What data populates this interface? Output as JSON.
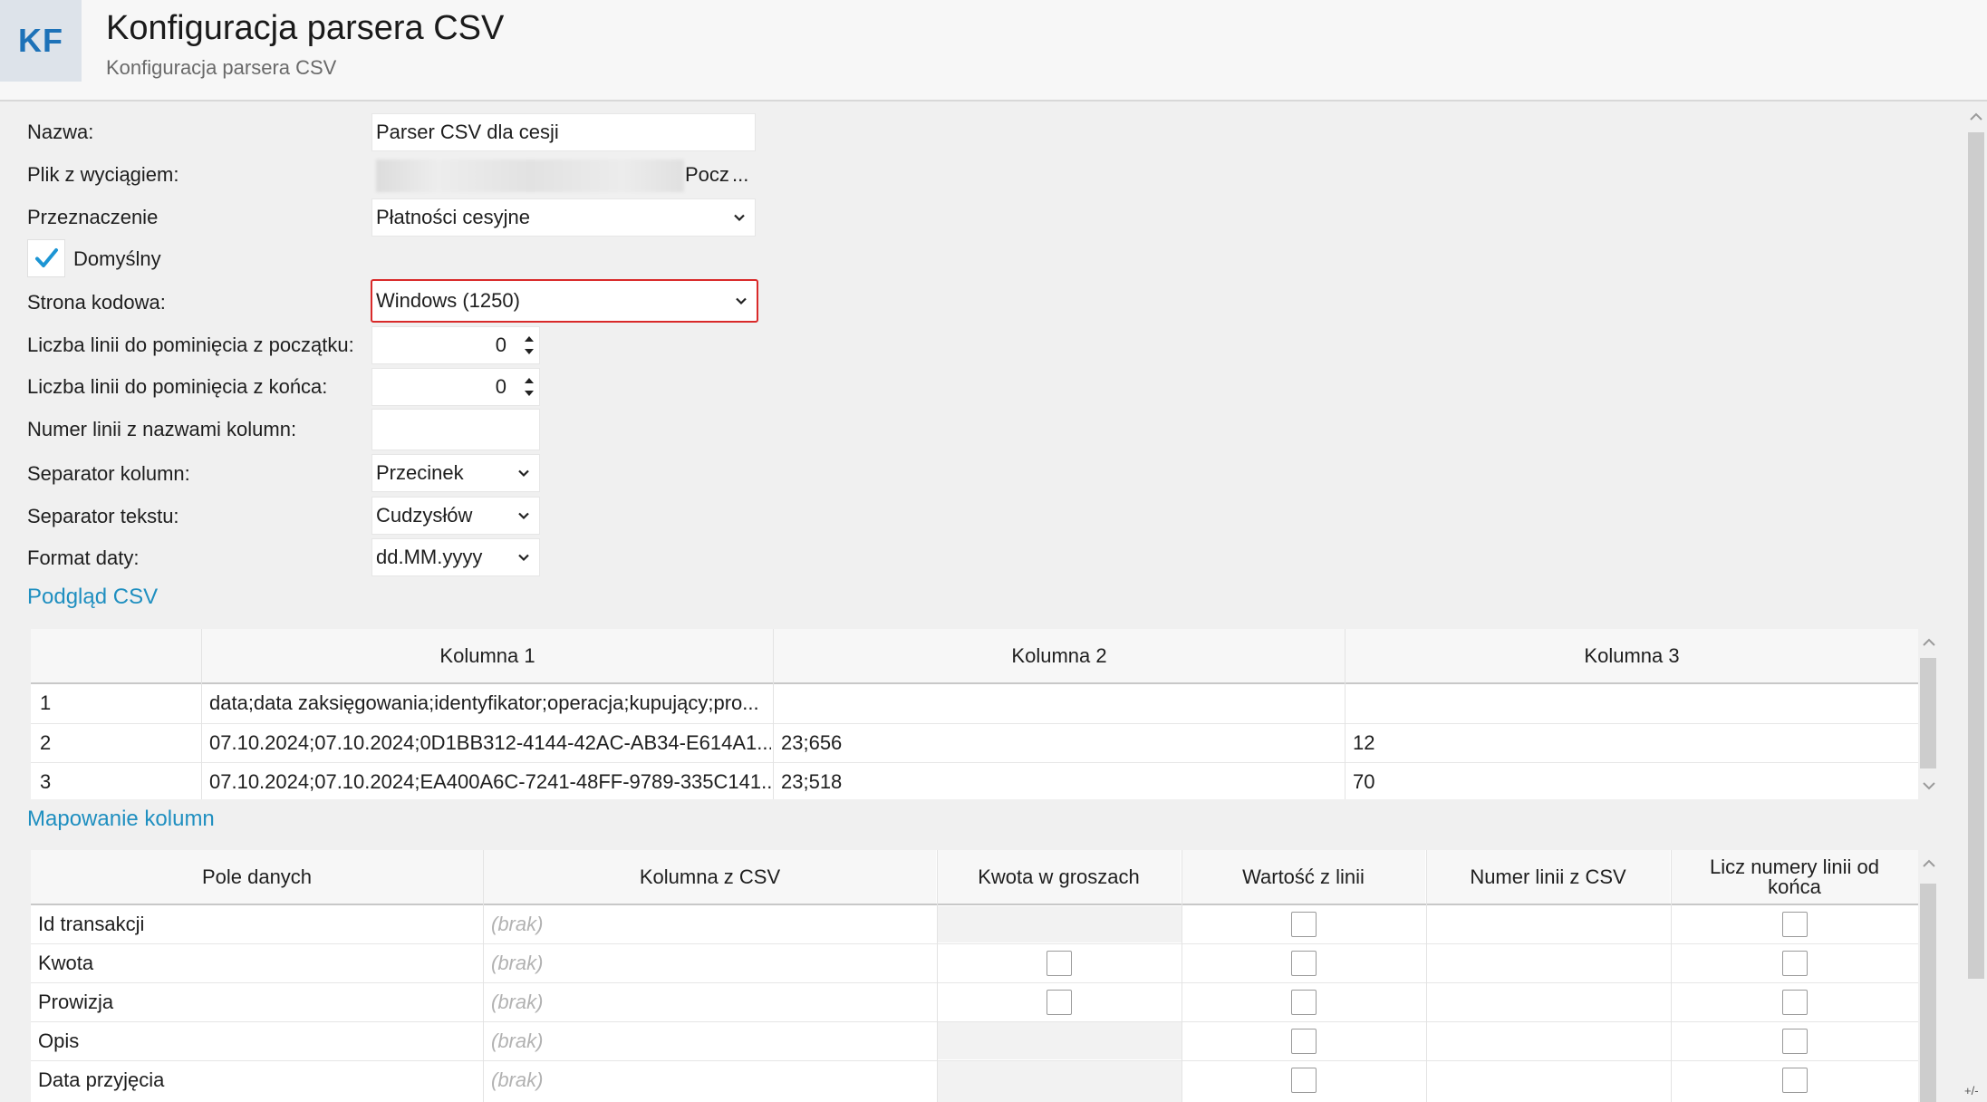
{
  "header": {
    "logo": "KF",
    "title": "Konfiguracja parsera CSV",
    "subtitle": "Konfiguracja parsera CSV"
  },
  "form": {
    "name_label": "Nazwa:",
    "name_value": "Parser CSV dla cesji",
    "file_label": "Plik z wyciągiem:",
    "file_value_visible": "Pocz",
    "file_browse": "...",
    "purpose_label": "Przeznaczenie",
    "purpose_value": "Płatności cesyjne",
    "default_label": "Domyślny",
    "default_checked": true,
    "encoding_label": "Strona kodowa:",
    "encoding_value": "Windows (1250)",
    "skip_start_label": "Liczba linii do pominięcia z początku:",
    "skip_start_value": "0",
    "skip_end_label": "Liczba linii do pominięcia z końca:",
    "skip_end_value": "0",
    "header_line_label": "Numer linii z nazwami kolumn:",
    "header_line_value": "",
    "col_sep_label": "Separator kolumn:",
    "col_sep_value": "Przecinek",
    "text_sep_label": "Separator tekstu:",
    "text_sep_value": "Cudzysłów",
    "date_format_label": "Format daty:",
    "date_format_value": "dd.MM.yyyy"
  },
  "preview": {
    "section_title": "Podgląd CSV",
    "columns": [
      "",
      "Kolumna 1",
      "Kolumna 2",
      "Kolumna 3"
    ],
    "rows": [
      [
        "1",
        "data;data zaksięgowania;identyfikator;operacja;kupujący;pro...",
        "",
        ""
      ],
      [
        "2",
        "07.10.2024;07.10.2024;0D1BB312-4144-42AC-AB34-E614A1...",
        "23;656",
        "12"
      ],
      [
        "3",
        "07.10.2024;07.10.2024;EA400A6C-7241-48FF-9789-335C141...",
        "23;518",
        "70"
      ]
    ]
  },
  "mapping": {
    "section_title": "Mapowanie kolumn",
    "columns": [
      "Pole danych",
      "Kolumna z CSV",
      "Kwota w groszach",
      "Wartość z linii",
      "Numer linii z CSV",
      "Licz numery linii od końca"
    ],
    "rows": [
      {
        "field": "Id transakcji",
        "csv_col": "(brak)",
        "grosze": null,
        "from_line": false,
        "line_no": "",
        "from_end": false
      },
      {
        "field": "Kwota",
        "csv_col": "(brak)",
        "grosze": false,
        "from_line": false,
        "line_no": "",
        "from_end": false
      },
      {
        "field": "Prowizja",
        "csv_col": "(brak)",
        "grosze": false,
        "from_line": false,
        "line_no": "",
        "from_end": false
      },
      {
        "field": "Opis",
        "csv_col": "(brak)",
        "grosze": null,
        "from_line": false,
        "line_no": "",
        "from_end": false
      },
      {
        "field": "Data przyjęcia",
        "csv_col": "(brak)",
        "grosze": null,
        "from_line": false,
        "line_no": "",
        "from_end": false
      }
    ]
  },
  "corner_text": "+/-"
}
